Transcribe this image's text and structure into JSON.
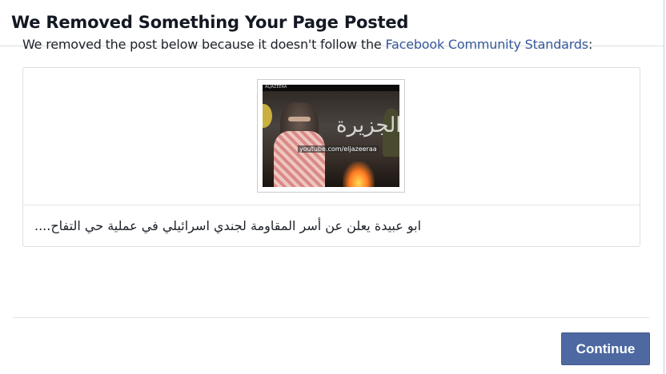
{
  "dialog": {
    "title": "We Removed Something Your Page Posted",
    "intro_text": "We removed the post below because it doesn't follow the ",
    "intro_link": "Facebook Community Standards",
    "intro_suffix": ":",
    "post": {
      "thumbnail_overlay_url": "youtube.com/eljazeeraa",
      "thumbnail_banner": "ALJAZEERA",
      "thumbnail_calligraphy": "الجزيرة",
      "caption": "ابو عبيدة يعلن عن أسر المقاومة لجندي اسرائيلي في عملية حي التفاح...."
    },
    "continue_label": "Continue"
  },
  "colors": {
    "link": "#365899",
    "button": "#4e69a2"
  }
}
